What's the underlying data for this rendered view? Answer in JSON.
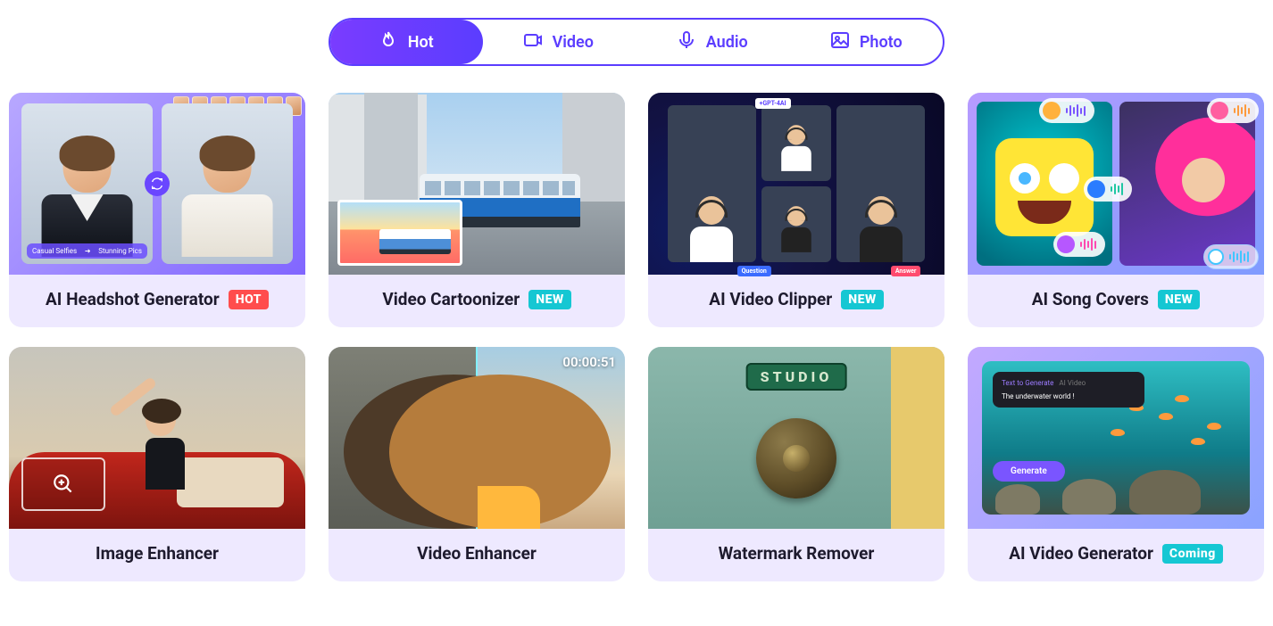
{
  "tabs": [
    {
      "id": "hot",
      "label": "Hot",
      "icon": "flame",
      "active": true
    },
    {
      "id": "video",
      "label": "Video",
      "icon": "video",
      "active": false
    },
    {
      "id": "audio",
      "label": "Audio",
      "icon": "mic",
      "active": false
    },
    {
      "id": "photo",
      "label": "Photo",
      "icon": "image",
      "active": false
    }
  ],
  "badges": {
    "hot": {
      "text": "HOT",
      "color": "#ff4d4d"
    },
    "new": {
      "text": "NEW",
      "color": "#15c7d3"
    },
    "coming": {
      "text": "Coming",
      "color": "#15c7d3"
    }
  },
  "tools": [
    {
      "title": "AI Headshot Generator",
      "badge": "hot"
    },
    {
      "title": "Video Cartoonizer",
      "badge": "new"
    },
    {
      "title": "AI Video Clipper",
      "badge": "new"
    },
    {
      "title": "AI Song Covers",
      "badge": "new"
    },
    {
      "title": "Image Enhancer",
      "badge": null
    },
    {
      "title": "Video Enhancer",
      "badge": null
    },
    {
      "title": "Watermark Remover",
      "badge": null
    },
    {
      "title": "AI Video Generator",
      "badge": "coming"
    }
  ],
  "thumbs": {
    "headshot": {
      "chip_left": "Casual Selfies",
      "chip_arrow": "➜",
      "chip_right": "Stunning Pics"
    },
    "clipper": {
      "tag_center": "+GPT-4AI",
      "tag_q": "Question",
      "tag_a": "Answer"
    },
    "venh": {
      "timestamp": "00:00:51"
    },
    "wm": {
      "plaque": "STUDIO"
    },
    "gen": {
      "tab_active": "Text to Generate",
      "tab_inactive": "AI Video",
      "prompt": "The underwater world !",
      "button": "Generate"
    }
  }
}
